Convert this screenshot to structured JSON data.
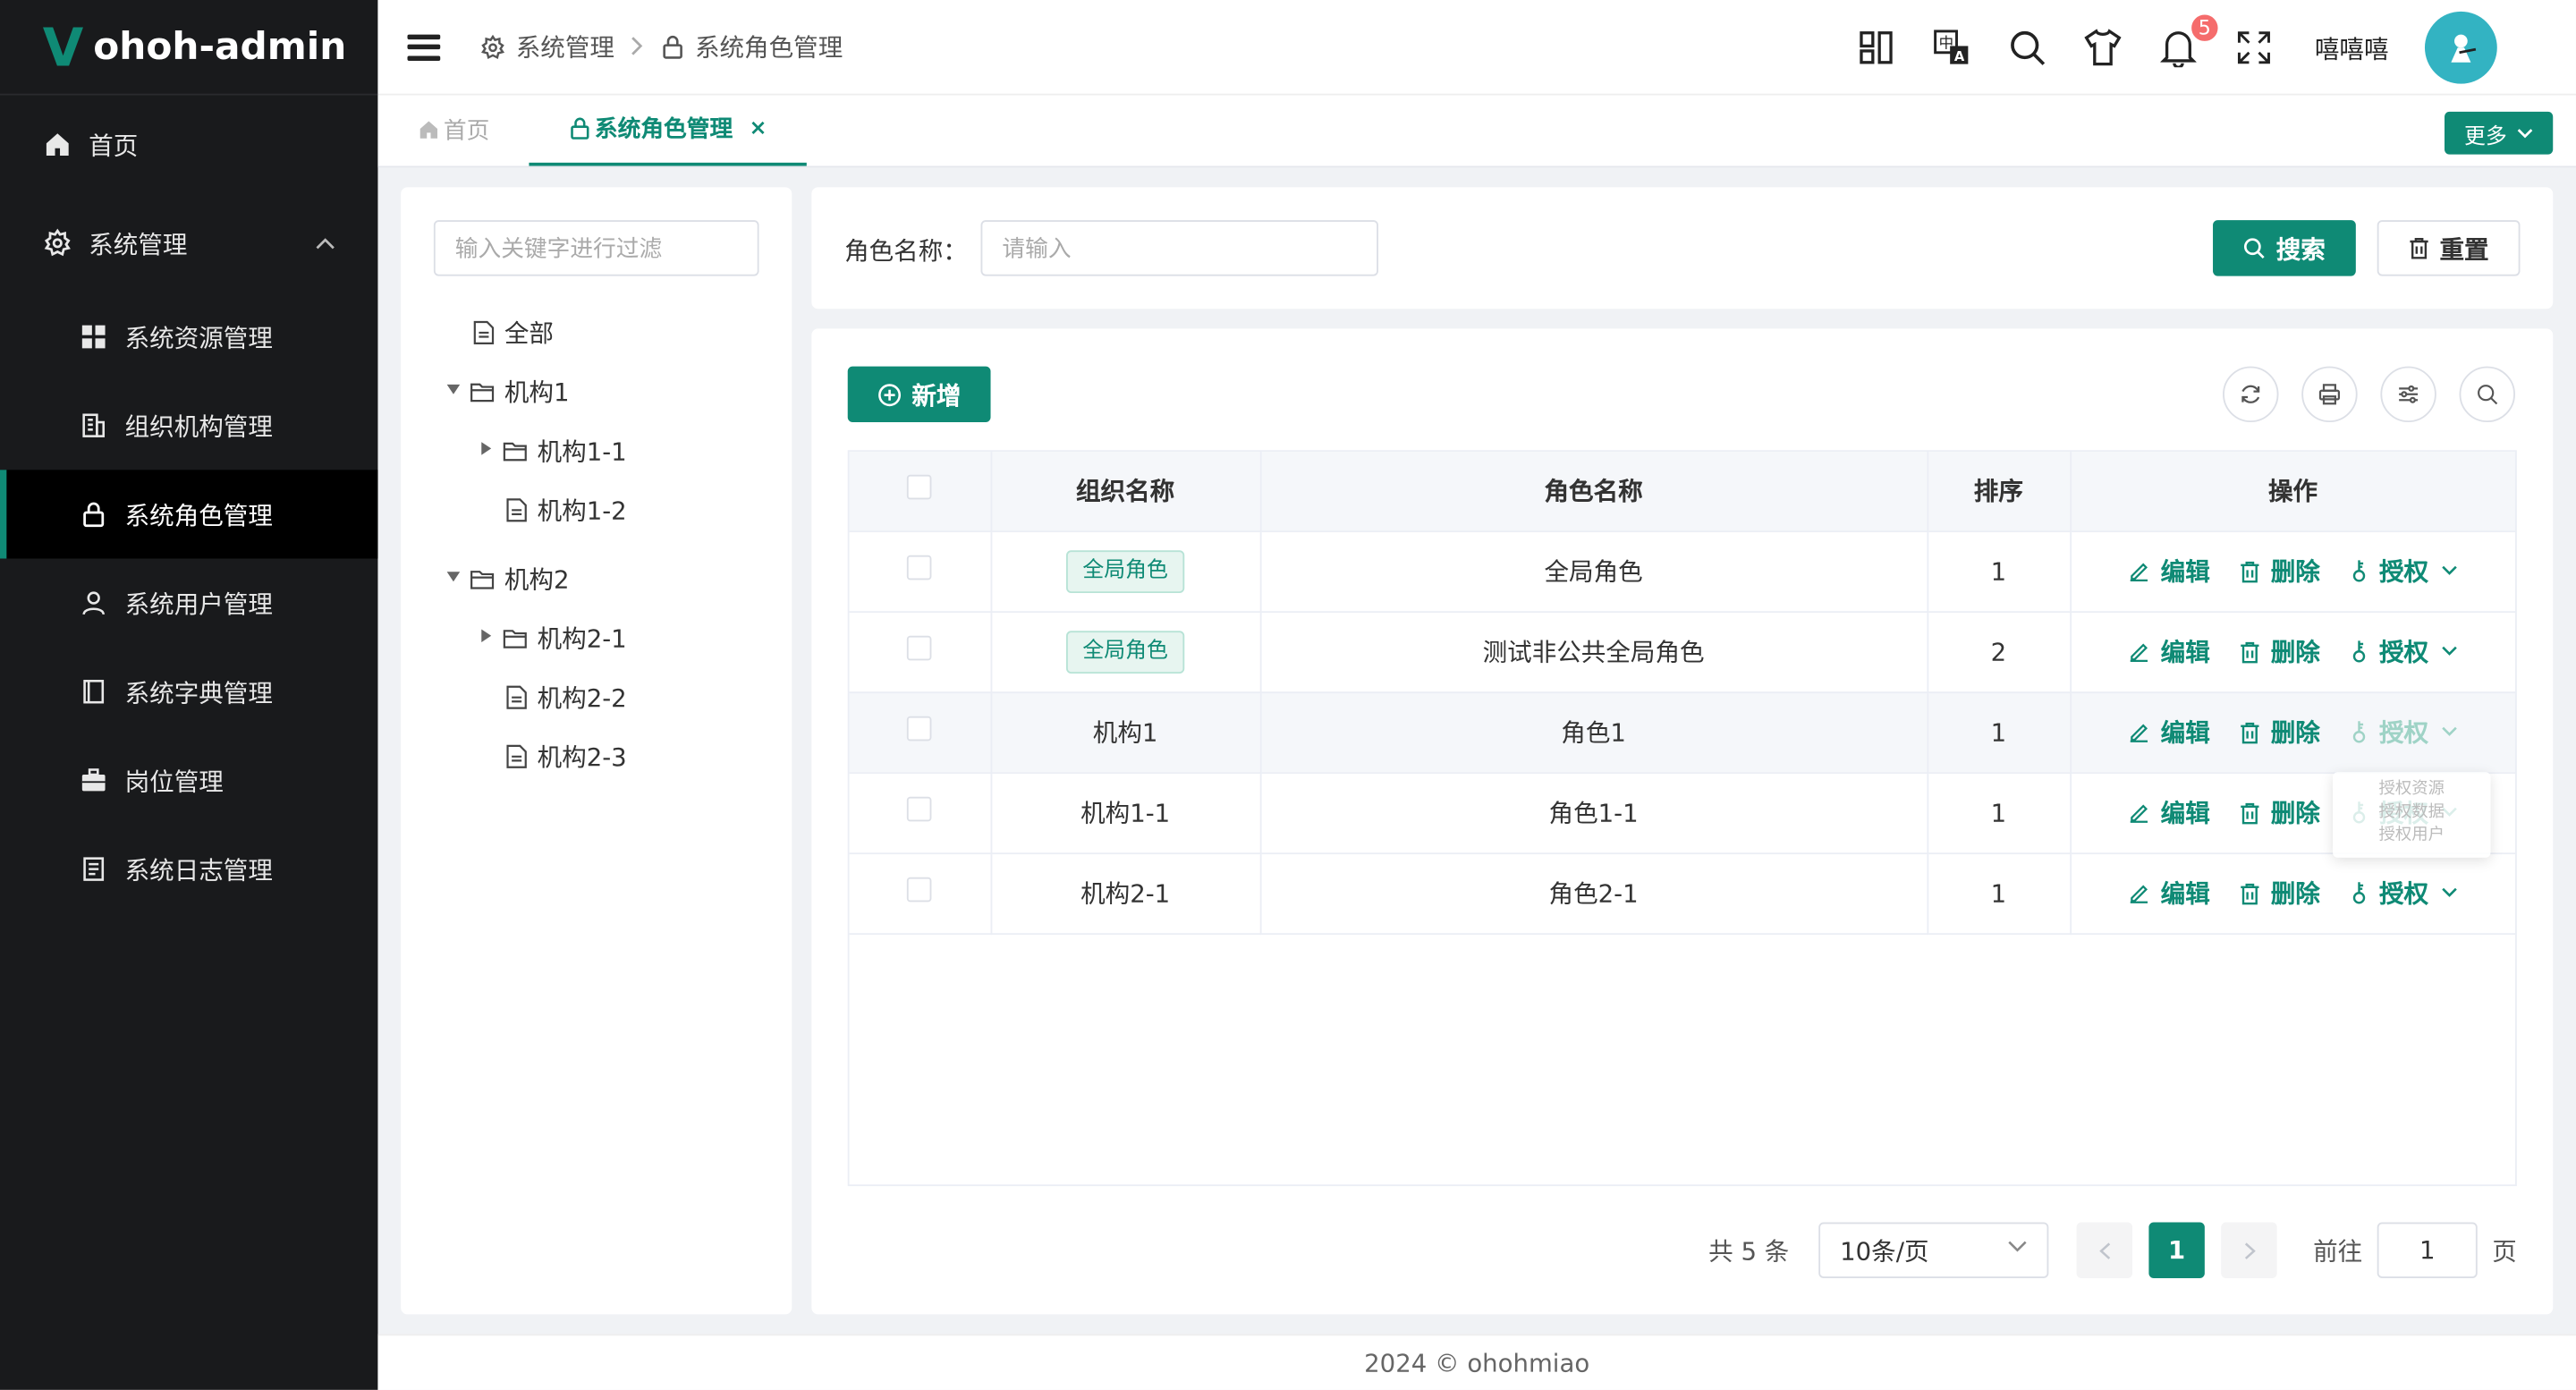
{
  "app": {
    "name": "ohoh-admin"
  },
  "sidebar": {
    "items": [
      {
        "label": "首页",
        "icon": "home-icon"
      },
      {
        "label": "系统管理",
        "icon": "gear-icon",
        "expanded": true
      },
      {
        "label": "系统资源管理",
        "icon": "grid-icon"
      },
      {
        "label": "组织机构管理",
        "icon": "building-icon"
      },
      {
        "label": "系统角色管理",
        "icon": "lock-icon",
        "active": true
      },
      {
        "label": "系统用户管理",
        "icon": "user-icon"
      },
      {
        "label": "系统字典管理",
        "icon": "book-icon"
      },
      {
        "label": "岗位管理",
        "icon": "briefcase-icon"
      },
      {
        "label": "系统日志管理",
        "icon": "log-icon"
      }
    ]
  },
  "header": {
    "breadcrumb": [
      "系统管理",
      "系统角色管理"
    ],
    "notification_count": "5",
    "username": "嘻嘻嘻"
  },
  "tabs": {
    "items": [
      {
        "label": "首页",
        "active": false
      },
      {
        "label": "系统角色管理",
        "active": true,
        "close": "×"
      }
    ],
    "more_label": "更多"
  },
  "tree": {
    "filter_placeholder": "输入关键字进行过滤",
    "nodes": [
      {
        "label": "全部"
      },
      {
        "label": "机构1"
      },
      {
        "label": "机构1-1"
      },
      {
        "label": "机构1-2"
      },
      {
        "label": "机构2"
      },
      {
        "label": "机构2-1"
      },
      {
        "label": "机构2-2"
      },
      {
        "label": "机构2-3"
      }
    ]
  },
  "search": {
    "label": "角色名称：",
    "placeholder": "请输入",
    "search_label": "搜索",
    "reset_label": "重置"
  },
  "table": {
    "add_label": "新增",
    "columns": [
      "组织名称",
      "角色名称",
      "排序",
      "操作"
    ],
    "rows": [
      {
        "org": "全局角色",
        "org_is_tag": true,
        "role": "全局角色",
        "sort": "1"
      },
      {
        "org": "全局角色",
        "org_is_tag": true,
        "role": "测试非公共全局角色",
        "sort": "2"
      },
      {
        "org": "机构1",
        "org_is_tag": false,
        "role": "角色1",
        "sort": "1"
      },
      {
        "org": "机构1-1",
        "org_is_tag": false,
        "role": "角色1-1",
        "sort": "1"
      },
      {
        "org": "机构2-1",
        "org_is_tag": false,
        "role": "角色2-1",
        "sort": "1"
      }
    ],
    "ops": {
      "edit": "编辑",
      "delete": "删除",
      "grant": "授权"
    },
    "dropdown": [
      "授权资源",
      "授权数据",
      "授权用户"
    ]
  },
  "pagination": {
    "total": "共 5 条",
    "page_size": "10条/页",
    "current": "1",
    "goto_label": "前往",
    "goto_value": "1",
    "unit": "页"
  },
  "footer": {
    "text": "2024 © ohohmiao"
  },
  "colors": {
    "primary": "#0f8a75",
    "sidebar_bg": "#191a1c",
    "badge": "#f56c6c"
  }
}
